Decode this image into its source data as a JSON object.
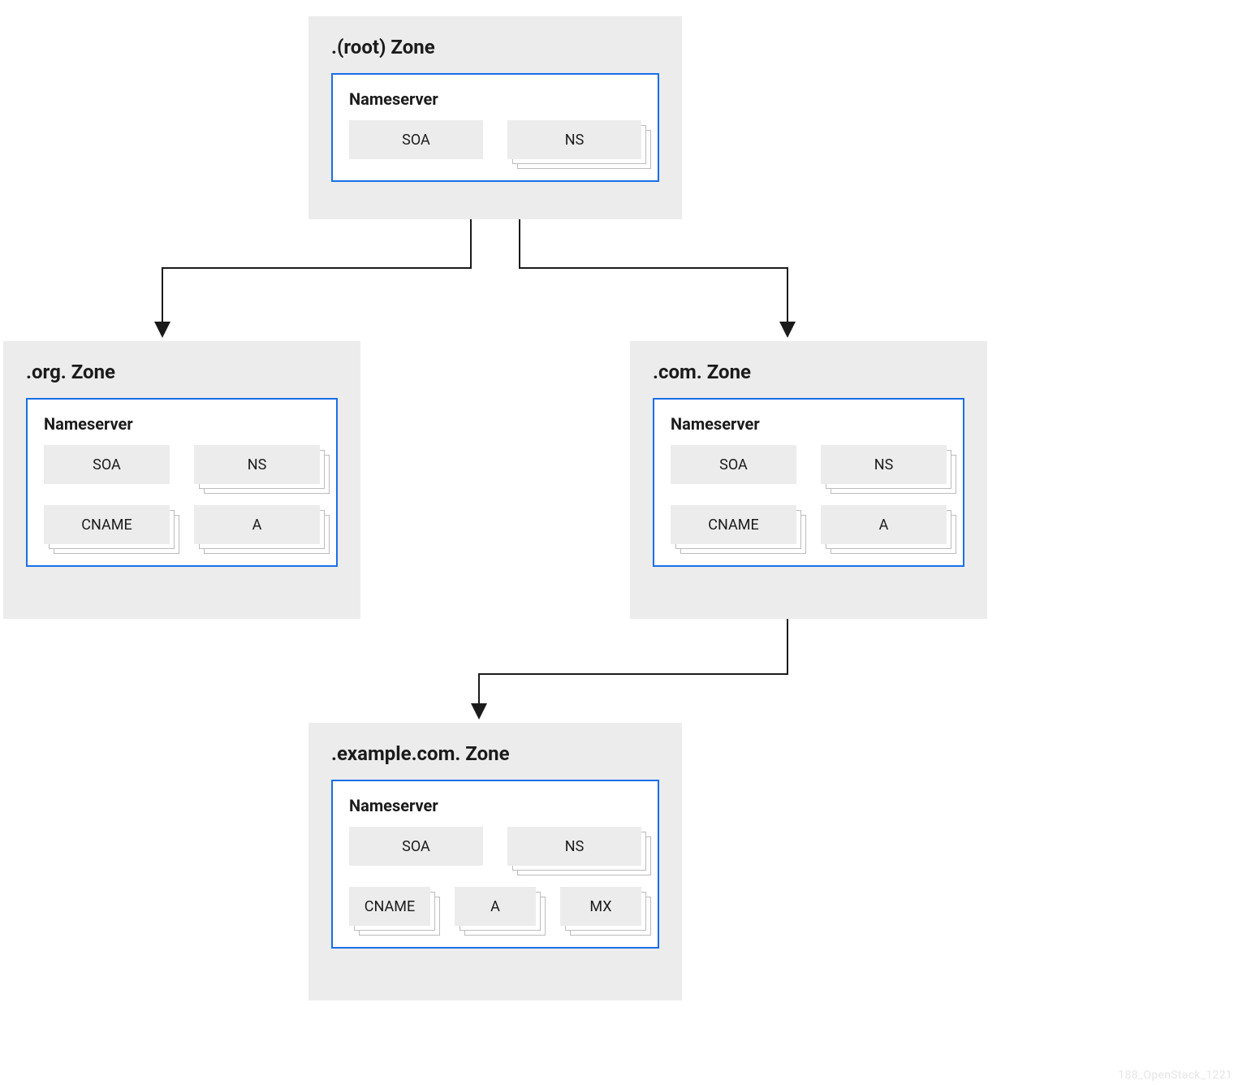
{
  "zones": {
    "root": {
      "title": ".(root) Zone",
      "ns_label": "Nameserver",
      "records": [
        [
          {
            "label": "SOA",
            "stack": false
          },
          {
            "label": "NS",
            "stack": true
          }
        ]
      ]
    },
    "org": {
      "title": ".org. Zone",
      "ns_label": "Nameserver",
      "records": [
        [
          {
            "label": "SOA",
            "stack": false
          },
          {
            "label": "NS",
            "stack": true
          }
        ],
        [
          {
            "label": "CNAME",
            "stack": true
          },
          {
            "label": "A",
            "stack": true
          }
        ]
      ]
    },
    "com": {
      "title": ".com. Zone",
      "ns_label": "Nameserver",
      "records": [
        [
          {
            "label": "SOA",
            "stack": false
          },
          {
            "label": "NS",
            "stack": true
          }
        ],
        [
          {
            "label": "CNAME",
            "stack": true
          },
          {
            "label": "A",
            "stack": true
          }
        ]
      ]
    },
    "example": {
      "title": ".example.com. Zone",
      "ns_label": "Nameserver",
      "records": [
        [
          {
            "label": "SOA",
            "stack": false
          },
          {
            "label": "NS",
            "stack": true
          }
        ],
        [
          {
            "label": "CNAME",
            "stack": true
          },
          {
            "label": "A",
            "stack": true
          },
          {
            "label": "MX",
            "stack": true
          }
        ]
      ]
    }
  },
  "watermark": "188_OpenStack_1221"
}
